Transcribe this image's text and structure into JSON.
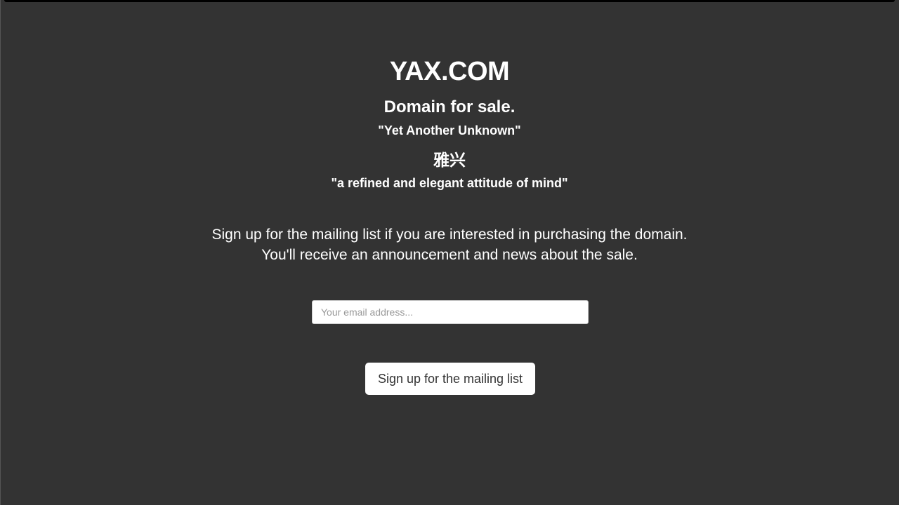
{
  "page": {
    "title": "YAX.COM",
    "subtitle": "Domain for sale.",
    "quote_en": "\"Yet Another Unknown\"",
    "chinese_name": "雅兴",
    "quote_cn": "\"a refined and elegant attitude of mind\""
  },
  "info": {
    "line1": "Sign up for the mailing list if you are interested in purchasing the domain.",
    "line2": "You'll receive an announcement and news about the sale."
  },
  "form": {
    "email_placeholder": "Your email address...",
    "email_value": "",
    "submit_label": "Sign up for the mailing list"
  },
  "colors": {
    "background": "#333333",
    "text": "#ffffff",
    "button_bg": "#ffffff",
    "button_text": "#333333"
  }
}
